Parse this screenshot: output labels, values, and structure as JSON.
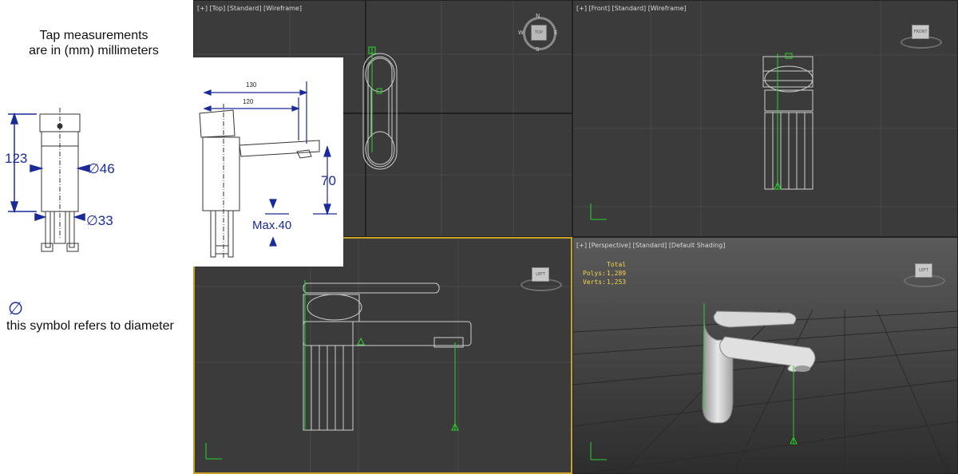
{
  "reference": {
    "title_line1": "Tap measurements",
    "title_line2": "are in (mm) millimeters",
    "dim_height": "123",
    "dim_dia_top": "∅46",
    "dim_dia_bottom": "∅33",
    "diameter_symbol": "∅",
    "diameter_note": "this symbol refers to diameter",
    "drawing": {
      "dim_130": "130",
      "dim_120": "120",
      "dim_70": "70",
      "dim_max40": "Max.40"
    }
  },
  "viewports": {
    "top": {
      "label_plus": "[+]",
      "label_view": "[Top]",
      "label_style": "[Standard]",
      "label_shading": "[Wireframe]",
      "cube_face": "TOP",
      "compass": {
        "n": "N",
        "s": "S",
        "e": "E",
        "w": "W"
      }
    },
    "front": {
      "label_plus": "[+]",
      "label_view": "[Front]",
      "label_style": "[Standard]",
      "label_shading": "[Wireframe]",
      "cube_face": "FRONT"
    },
    "left": {
      "cube_face": "LEFT"
    },
    "perspective": {
      "label_plus": "[+]",
      "label_view": "[Perspective]",
      "label_style": "[Standard]",
      "label_shading": "[Default Shading]",
      "cube_face": "LEFT",
      "stats": {
        "header": "Total",
        "polys_label": "Polys:",
        "polys_value": "1,289",
        "verts_label": "Verts:",
        "verts_value": "1,253"
      }
    }
  },
  "colors": {
    "viewport_bg": "#3b3b3b",
    "wire": "#cfcfcf",
    "helper": "#25d425",
    "active_border": "#c9a227",
    "dim_blue": "#1a2a9a"
  }
}
